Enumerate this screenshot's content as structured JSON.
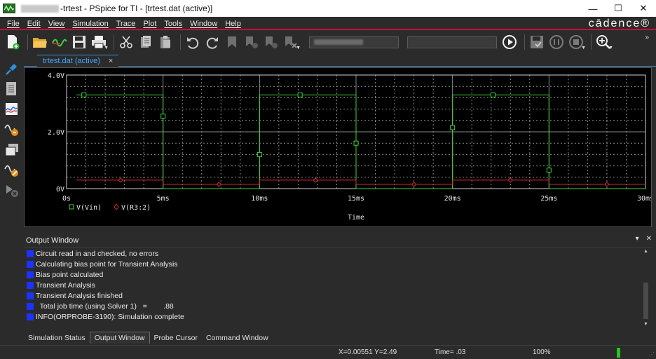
{
  "window": {
    "title_suffix": "-trtest - PSpice for TI - [trtest.dat (active)]",
    "minimize": "—",
    "maximize": "☐",
    "close": "✕"
  },
  "menu": {
    "items": [
      "File",
      "Edit",
      "View",
      "Simulation",
      "Trace",
      "Plot",
      "Tools",
      "Window",
      "Help"
    ],
    "brand": "cādence®"
  },
  "toolbar": {
    "overflow": "»"
  },
  "tab": {
    "label": "trtest.dat (active)",
    "close": "×"
  },
  "plot": {
    "colors": {
      "grid": "#8a8a8a",
      "vin": "#3fd13f",
      "r3": "#d82e2e",
      "axis_text": "#e8e8e8"
    }
  },
  "chart_data": {
    "type": "line",
    "xlabel": "Time",
    "ylabel": "",
    "xlim": [
      0,
      30
    ],
    "ylim": [
      0,
      4.0
    ],
    "x_ticks": [
      0,
      5,
      10,
      15,
      20,
      25,
      30
    ],
    "x_tick_labels": [
      "0s",
      "5ms",
      "10ms",
      "15ms",
      "20ms",
      "25ms",
      "30ms"
    ],
    "y_ticks": [
      0,
      2.0,
      4.0
    ],
    "y_tick_labels": [
      "0V",
      "2.0V",
      "4.0V"
    ],
    "grid": true,
    "legend": "bottom-left",
    "series": [
      {
        "name": "V(Vin)",
        "marker": "square",
        "color": "#3fd13f",
        "x": [
          0.5,
          5,
          5,
          10,
          10,
          15,
          15,
          20,
          20,
          25,
          25,
          30
        ],
        "y": [
          3.3,
          3.3,
          0,
          0,
          3.3,
          3.3,
          0,
          0,
          3.3,
          3.3,
          0,
          0
        ],
        "markers_x": [
          0.9,
          5.0,
          10.0,
          12.1,
          15.0,
          20.0,
          22.1,
          25.0
        ],
        "markers_y": [
          3.3,
          2.55,
          1.2,
          3.3,
          1.6,
          2.15,
          3.3,
          0.65
        ]
      },
      {
        "name": "V(R3:2)",
        "marker": "diamond",
        "color": "#d82e2e",
        "x": [
          0.5,
          5,
          5,
          10,
          10,
          15,
          15,
          20,
          20,
          25,
          25,
          30
        ],
        "y": [
          0.3,
          0.3,
          0.15,
          0.15,
          0.3,
          0.3,
          0.15,
          0.15,
          0.3,
          0.3,
          0.15,
          0.15
        ],
        "markers_x": [
          2.8,
          7.9,
          12.9,
          18.0,
          23.0,
          28.0
        ],
        "markers_y": [
          0.3,
          0.15,
          0.3,
          0.15,
          0.3,
          0.15
        ]
      }
    ]
  },
  "output": {
    "title": "Output Window",
    "pin": "▾",
    "close": "✕",
    "lines": [
      "Circuit read in and checked, no errors",
      "Calculating bias point for Transient Analysis",
      "Bias point calculated",
      "Transient Analysis",
      "Transient Analysis finished",
      "  Total job time (using Solver 1)   =        .88",
      "INFO(ORPROBE-3190): Simulation complete"
    ]
  },
  "bottom_tabs": [
    "Simulation Status",
    "Output Window",
    "Probe Cursor",
    "Command Window"
  ],
  "status": {
    "xy": "X=0.00551  Y=2.49",
    "time": "Time= .03",
    "zoom": "100%"
  }
}
